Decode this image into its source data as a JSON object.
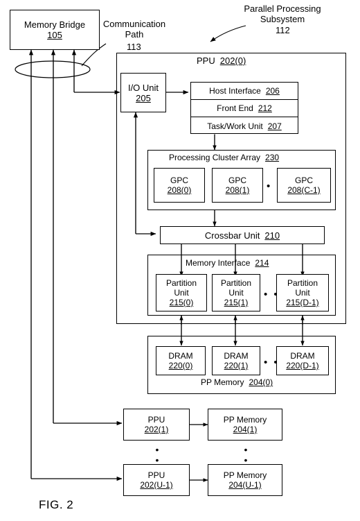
{
  "figure": {
    "caption": "FIG. 2",
    "labels": {
      "communication_path": "Communication\nPath",
      "communication_path_num": "113",
      "parallel_processing_subsystem": "Parallel Processing\nSubsystem",
      "parallel_processing_subsystem_num": "112"
    }
  },
  "memory_bridge": {
    "name": "Memory Bridge",
    "num": "105"
  },
  "ppu0": {
    "name": "PPU",
    "num": "202(0)",
    "io_unit": {
      "name": "I/O Unit",
      "num": "205"
    },
    "host_interface": {
      "name": "Host Interface",
      "num": "206"
    },
    "front_end": {
      "name": "Front End",
      "num": "212"
    },
    "task_work_unit": {
      "name": "Task/Work Unit",
      "num": "207"
    },
    "processing_cluster_array": {
      "name": "Processing Cluster Array",
      "num": "230",
      "gpcs": [
        {
          "name": "GPC",
          "num": "208(0)"
        },
        {
          "name": "GPC",
          "num": "208(1)"
        },
        {
          "name": "GPC",
          "num": "208(C-1)"
        }
      ],
      "ellipsis": "• • •"
    },
    "crossbar_unit": {
      "name": "Crossbar Unit",
      "num": "210"
    },
    "memory_interface": {
      "name": "Memory Interface",
      "num": "214",
      "partition_units": [
        {
          "name": "Partition\nUnit",
          "line1": "Partition",
          "line2": "Unit",
          "num": "215(0)"
        },
        {
          "name": "Partition\nUnit",
          "line1": "Partition",
          "line2": "Unit",
          "num": "215(1)"
        },
        {
          "name": "Partition\nUnit",
          "line1": "Partition",
          "line2": "Unit",
          "num": "215(D-1)"
        }
      ],
      "ellipsis": "• • •"
    }
  },
  "pp_memory0": {
    "name": "PP Memory",
    "num": "204(0)",
    "drams": [
      {
        "name": "DRAM",
        "num": "220(0)"
      },
      {
        "name": "DRAM",
        "num": "220(1)"
      },
      {
        "name": "DRAM",
        "num": "220(D-1)"
      }
    ],
    "ellipsis": "• • •"
  },
  "additional_units": {
    "vertical_ellipsis": "•\n•\n•",
    "rows": [
      {
        "ppu": {
          "name": "PPU",
          "num": "202(1)"
        },
        "memory": {
          "name": "PP Memory",
          "num": "204(1)"
        }
      },
      {
        "ppu": {
          "name": "PPU",
          "num": "202(U-1)"
        },
        "memory": {
          "name": "PP Memory",
          "num": "204(U-1)"
        }
      }
    ]
  },
  "colors": {
    "stroke": "#000000",
    "background": "#ffffff"
  }
}
